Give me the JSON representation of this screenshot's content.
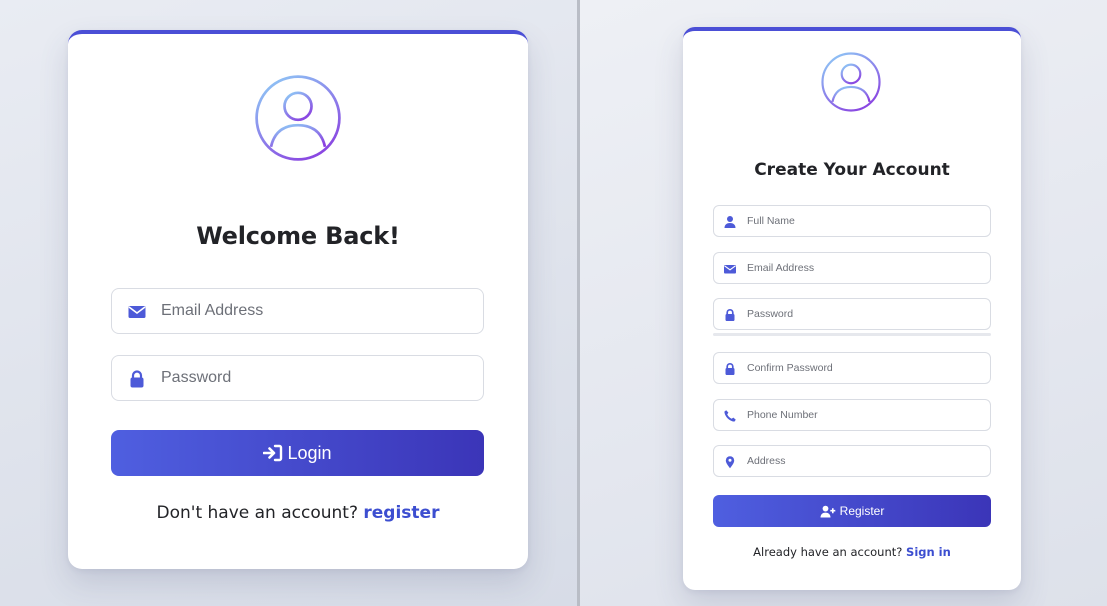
{
  "login": {
    "title": "Welcome Back!",
    "email_placeholder": "Email Address",
    "password_placeholder": "Password",
    "button_label": "Login",
    "switch_text": "Don't have an account?",
    "switch_link": "register"
  },
  "register": {
    "title": "Create Your Account",
    "fields": {
      "full_name": "Full Name",
      "email": "Email Address",
      "password": "Password",
      "confirm_password": "Confirm Password",
      "phone": "Phone Number",
      "address": "Address"
    },
    "button_label": "Register",
    "switch_text": "Already have an account?",
    "switch_link": "Sign in"
  },
  "icons": {
    "avatar": "user-circle-icon",
    "email": "envelope-icon",
    "password": "lock-icon",
    "full_name": "user-icon",
    "phone": "phone-icon",
    "address": "map-pin-icon",
    "login_button": "sign-in-icon",
    "register_button": "user-plus-icon"
  },
  "colors": {
    "accent": "#4b4fd6",
    "button_start": "#4f5fe0",
    "button_end": "#3b35b8",
    "link": "#3c4ed0",
    "avatar_gradient_start": "#8ec5f5",
    "avatar_gradient_end": "#8a3ee0"
  }
}
